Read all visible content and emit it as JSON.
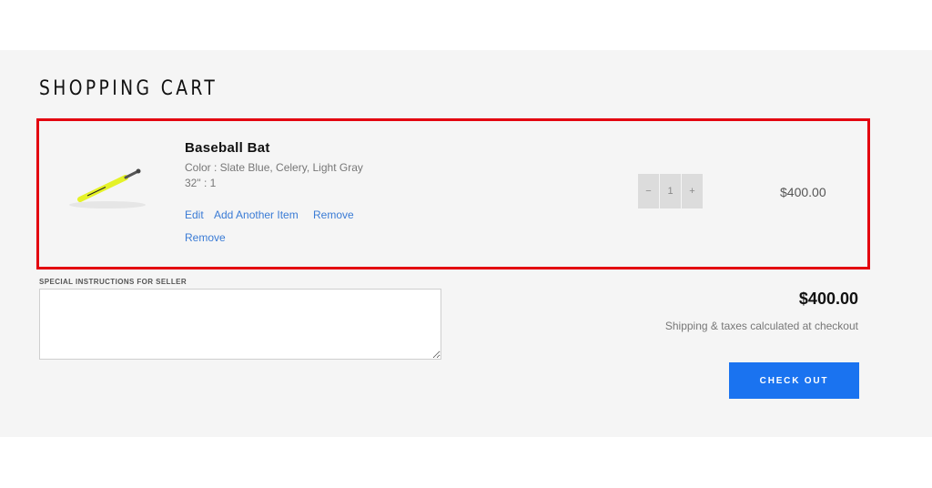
{
  "page": {
    "title": "SHOPPING CART"
  },
  "cart": {
    "items": [
      {
        "name": "Baseball Bat",
        "variant_color": "Color : Slate Blue, Celery, Light Gray",
        "variant_size": "32\" : 1",
        "actions": {
          "edit": "Edit",
          "add_another": "Add Another Item",
          "remove": "Remove",
          "remove_secondary": "Remove"
        },
        "quantity": {
          "minus": "−",
          "value": "1",
          "plus": "+"
        },
        "price": "$400.00"
      }
    ]
  },
  "notes": {
    "label": "SPECIAL INSTRUCTIONS FOR SELLER",
    "value": "",
    "placeholder": ""
  },
  "summary": {
    "subtotal": "$400.00",
    "shipping_note": "Shipping & taxes calculated at checkout",
    "checkout_label": "CHECK OUT"
  },
  "colors": {
    "highlight_border": "#e3000f",
    "checkout_button": "#1a73f0",
    "link": "#3a7bd5",
    "panel_background": "#f5f5f5"
  },
  "icons": {
    "product": "baseball-bat-image",
    "resize": "resize-handle-icon"
  }
}
